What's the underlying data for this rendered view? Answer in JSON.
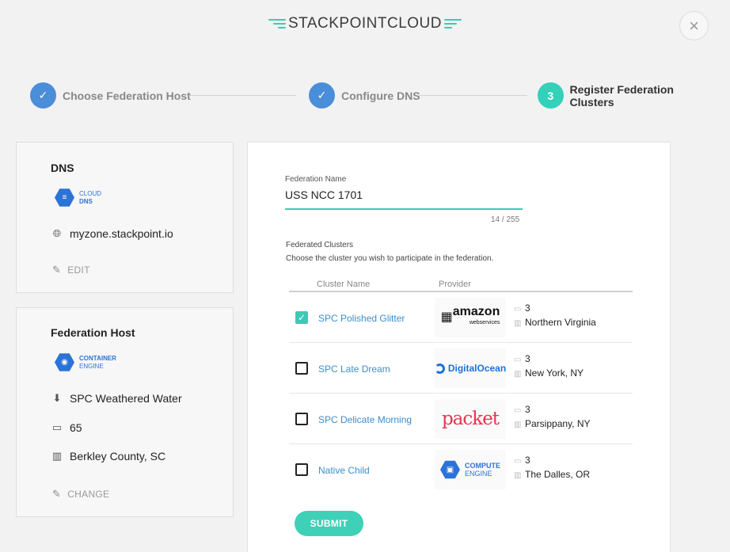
{
  "header": {
    "logo_part1": "STACK",
    "logo_part2": "POINT",
    "logo_part3": "CLOUD",
    "close_glyph": "×"
  },
  "stepper": {
    "steps": [
      {
        "label": "Choose Federation Host",
        "state": "done",
        "marker": "✓"
      },
      {
        "label": "Configure DNS",
        "state": "done",
        "marker": "✓"
      },
      {
        "label": "Register Federation Clusters",
        "state": "active",
        "marker": "3"
      }
    ]
  },
  "dns_card": {
    "title": "DNS",
    "badge_line1": "CLOUD",
    "badge_line2": "DNS",
    "zone": "myzone.stackpoint.io",
    "edit_label": "EDIT"
  },
  "host_card": {
    "title": "Federation Host",
    "badge_line1": "CONTAINER",
    "badge_line2": "ENGINE",
    "cluster": "SPC Weathered Water",
    "nodes": "65",
    "location": "Berkley County, SC",
    "change_label": "CHANGE"
  },
  "form": {
    "federation_name_label": "Federation Name",
    "federation_name_value": "USS NCC 1701",
    "char_count": "14 / 255",
    "clusters_title": "Federated Clusters",
    "clusters_description": "Choose the cluster you wish to participate in the federation.",
    "col_cluster": "Cluster Name",
    "col_provider": "Provider",
    "clusters": [
      {
        "name": "SPC Polished Glitter",
        "checked": true,
        "provider": "amazon",
        "nodes": "3",
        "region": "Northern Virginia"
      },
      {
        "name": "SPC Late Dream",
        "checked": false,
        "provider": "digitalocean",
        "nodes": "3",
        "region": "New York, NY"
      },
      {
        "name": "SPC Delicate Morning",
        "checked": false,
        "provider": "packet",
        "nodes": "3",
        "region": "Parsippany, NY"
      },
      {
        "name": "Native Child",
        "checked": false,
        "provider": "gce",
        "nodes": "3",
        "region": "The Dalles, OR"
      }
    ],
    "provider_logos": {
      "amazon_main": "amazon",
      "amazon_sub": "webservices",
      "digitalocean": "DigitalOcean",
      "packet": "packet",
      "gce_line1": "COMPUTE",
      "gce_line2": "ENGINE"
    },
    "submit_label": "SUBMIT"
  },
  "colors": {
    "accent": "#3ec9b6",
    "step_done": "#4a8ed9",
    "link": "#3a8fd0",
    "gcp_blue": "#2b73d6"
  },
  "icons": {
    "check": "check-icon",
    "globe": "globe-icon",
    "pencil": "pencil-icon",
    "download": "server-icon",
    "monitor": "monitor-icon",
    "building": "building-icon"
  }
}
